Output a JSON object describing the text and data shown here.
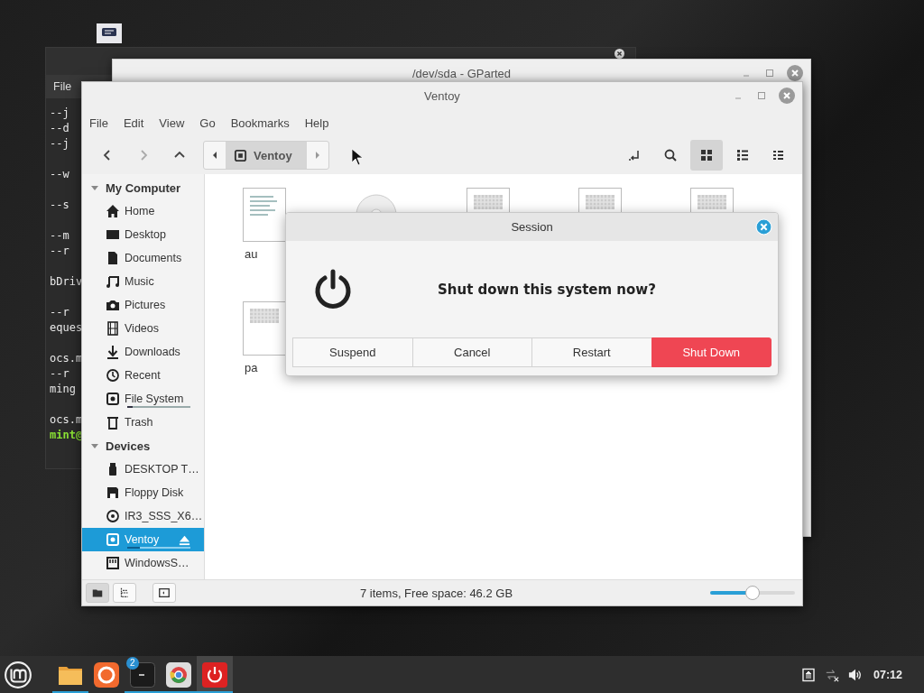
{
  "terminal": {
    "menu": [
      "File"
    ],
    "blocks": [
      [
        {
          "text": "--j",
          "kind": "output"
        },
        {
          "text": "--d",
          "kind": "output"
        },
        {
          "text": "--j",
          "kind": "output"
        }
      ],
      [
        {
          "text": "--w",
          "kind": "output"
        }
      ],
      [
        {
          "text": "--s",
          "kind": "output"
        }
      ],
      [
        {
          "text": "--m",
          "kind": "output"
        },
        {
          "text": "--r",
          "kind": "output"
        }
      ],
      [
        {
          "text": "bDriv",
          "kind": "output"
        }
      ],
      [
        {
          "text": "--r",
          "kind": "output"
        },
        {
          "text": "eques",
          "kind": "output"
        }
      ],
      [
        {
          "text": "ocs.m",
          "kind": "output"
        },
        {
          "text": "--r",
          "kind": "output"
        },
        {
          "text": "ming",
          "kind": "output"
        }
      ],
      [
        {
          "text": "ocs.m",
          "kind": "output"
        },
        {
          "text": "mint@",
          "kind": "prompt"
        }
      ]
    ]
  },
  "gparted": {
    "title": "/dev/sda - GParted"
  },
  "file_manager": {
    "title": "Ventoy",
    "menu": [
      "File",
      "Edit",
      "View",
      "Go",
      "Bookmarks",
      "Help"
    ],
    "toolbar": {
      "back_disabled": false,
      "forward_disabled": true,
      "path": [
        {
          "label": "Ventoy",
          "selected": true
        }
      ],
      "views": [
        {
          "kind": "icons",
          "selected": true
        },
        {
          "kind": "list",
          "selected": false
        },
        {
          "kind": "compact",
          "selected": false
        }
      ]
    },
    "sidebar": [
      {
        "title": "My Computer",
        "expanded": true,
        "items": [
          {
            "label": "Home",
            "kind": "home",
            "selected": false
          },
          {
            "label": "Desktop",
            "kind": "desktop",
            "selected": false
          },
          {
            "label": "Documents",
            "kind": "document",
            "selected": false
          },
          {
            "label": "Music",
            "kind": "music",
            "selected": false
          },
          {
            "label": "Pictures",
            "kind": "camera",
            "selected": false
          },
          {
            "label": "Videos",
            "kind": "film",
            "selected": false
          },
          {
            "label": "Downloads",
            "kind": "download",
            "selected": false
          },
          {
            "label": "Recent",
            "kind": "clock",
            "selected": false
          },
          {
            "label": "File System",
            "kind": "drive",
            "selected": false,
            "level": 0.08
          },
          {
            "label": "Trash",
            "kind": "trash",
            "selected": false
          }
        ]
      },
      {
        "title": "Devices",
        "expanded": true,
        "items": [
          {
            "label": "DESKTOP T…",
            "kind": "usb",
            "selected": false
          },
          {
            "label": "Floppy Disk",
            "kind": "floppy",
            "selected": false
          },
          {
            "label": "IR3_SSS_X6…",
            "kind": "disc",
            "selected": false
          },
          {
            "label": "Ventoy",
            "kind": "drive",
            "selected": true,
            "level": 0.2,
            "ejectable": true
          },
          {
            "label": "WindowsS…",
            "kind": "card",
            "selected": false
          }
        ]
      }
    ],
    "files": [
      {
        "kind": "text",
        "label": "au"
      },
      {
        "kind": "disc"
      },
      {
        "kind": "image"
      },
      {
        "kind": "image"
      },
      {
        "kind": "image"
      },
      {
        "kind": "image",
        "label": "pa"
      }
    ],
    "status_bar": {
      "panes": [
        {
          "kind": "places",
          "selected": true
        },
        {
          "kind": "tree",
          "selected": false
        }
      ],
      "text": "7 items, Free space: 46.2 GB",
      "zoom": {
        "level": 0.5
      }
    }
  },
  "dialog": {
    "title": "Session",
    "message": "Shut down this system now?",
    "buttons": [
      {
        "label": "Suspend",
        "kind": "normal"
      },
      {
        "label": "Cancel",
        "kind": "normal"
      },
      {
        "label": "Restart",
        "kind": "normal"
      },
      {
        "label": "Shut Down",
        "kind": "destructive"
      }
    ]
  },
  "taskbar": {
    "apps": [
      {
        "kind": "files",
        "running": true,
        "active": false
      },
      {
        "kind": "browser",
        "running": false,
        "active": false
      },
      {
        "kind": "terminal",
        "running": true,
        "active": false,
        "badge": "2"
      },
      {
        "kind": "chromium",
        "running": true,
        "active": false
      },
      {
        "kind": "power",
        "running": true,
        "active": true
      }
    ],
    "clock": "07:12"
  }
}
